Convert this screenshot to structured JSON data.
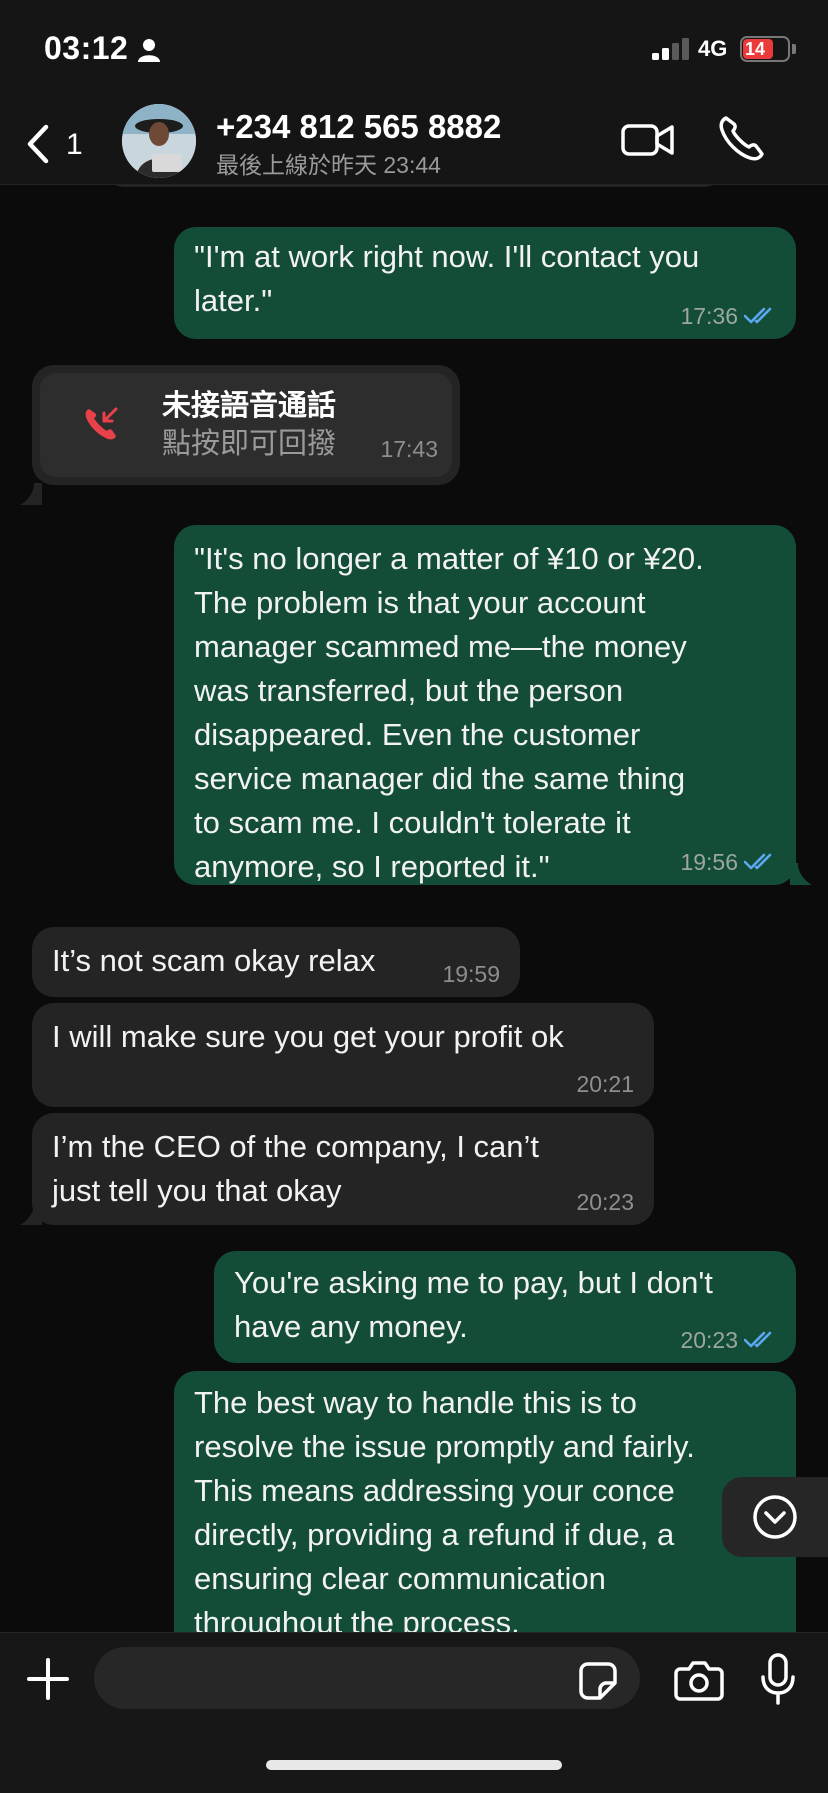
{
  "status_bar": {
    "time": "03:12",
    "network": "4G",
    "battery": "14"
  },
  "header": {
    "back_count": "1",
    "contact_name": "+234 812 565 8882",
    "last_seen": "最後上線於昨天 23:44"
  },
  "messages": [
    {
      "direction": "out",
      "text": "\"I'm at work right now. I'll contact you\nlater.\"",
      "time": "17:36",
      "read": true
    },
    {
      "direction": "in",
      "type": "missed_call",
      "title": "未接語音通話",
      "subtitle": "點按即可回撥",
      "time": "17:43"
    },
    {
      "direction": "out",
      "text": "\"It's no longer a matter of ¥10 or ¥20.\nThe problem is that your account\nmanager scammed me—the money\nwas transferred, but the person\ndisappeared. Even the customer\nservice manager did the same thing\nto scam me. I couldn't tolerate it\nanymore, so I reported it.\"",
      "time": "19:56",
      "read": true
    },
    {
      "direction": "in",
      "text": "It’s not scam okay relax",
      "time": "19:59"
    },
    {
      "direction": "in",
      "text": "I will make sure you get your profit ok",
      "time": "20:21"
    },
    {
      "direction": "in",
      "text": "I’m the CEO of the company, I can’t\njust tell you that okay",
      "time": "20:23"
    },
    {
      "direction": "out",
      "text": "You're asking me to pay, but I don't\nhave any money.",
      "time": "20:23",
      "read": true
    },
    {
      "direction": "out",
      "text": "The best way to handle this is to\nresolve the issue promptly and fairly.\nThis means addressing your conce\ndirectly, providing a refund if due, a\nensuring clear communication\nthroughout the process."
    }
  ],
  "icons": {
    "person": "person-icon",
    "back": "chevron-left-icon",
    "video": "video-camera-icon",
    "phone": "phone-icon",
    "missed_call": "missed-call-icon",
    "ticks": "double-check-icon",
    "scroll_down": "chevron-down-circle-icon",
    "plus": "plus-icon",
    "sticker": "sticker-icon",
    "camera": "camera-icon",
    "mic": "microphone-icon"
  },
  "colors": {
    "outgoing_bubble": "#134d37",
    "incoming_bubble": "#242424",
    "read_ticks": "#5aa9f0",
    "missed_call": "#e8414a",
    "background": "#0b0b0b"
  }
}
